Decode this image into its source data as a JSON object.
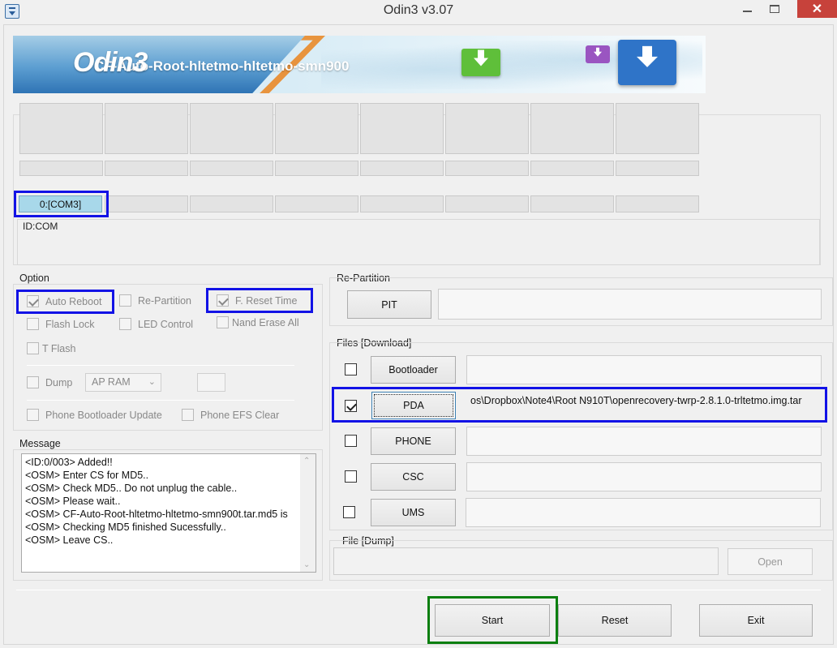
{
  "window": {
    "title": "Odin3 v3.07",
    "close_glyph": "✕"
  },
  "banner": {
    "logo": "Odin3",
    "filename": "CF-Auto-Root-hltetmo-hltetmo-smn900",
    "icons": [
      "download-green-icon",
      "download-purple-icon",
      "download-blue-icon"
    ]
  },
  "ports": {
    "com_active": "0:[COM3]",
    "id_com_label": "ID:COM"
  },
  "option": {
    "title": "Option",
    "auto_reboot": {
      "label": "Auto Reboot",
      "checked": true
    },
    "re_partition": {
      "label": "Re-Partition",
      "checked": false
    },
    "f_reset_time": {
      "label": "F. Reset Time",
      "checked": true
    },
    "flash_lock": {
      "label": "Flash Lock",
      "checked": false
    },
    "led_control": {
      "label": "LED Control",
      "checked": false
    },
    "nand_erase_all": {
      "label": "Nand Erase All",
      "checked": false
    },
    "t_flash": {
      "label": "T Flash",
      "checked": false
    },
    "dump": {
      "label": "Dump",
      "checked": false
    },
    "dump_select": "AP RAM",
    "phone_bootloader_update": {
      "label": "Phone Bootloader Update",
      "checked": false
    },
    "phone_efs_clear": {
      "label": "Phone EFS Clear",
      "checked": false
    }
  },
  "message": {
    "title": "Message",
    "lines": [
      "<ID:0/003> Added!!",
      "<OSM> Enter CS for MD5..",
      "<OSM> Check MD5.. Do not unplug the cable..",
      "<OSM> Please wait..",
      "<OSM> CF-Auto-Root-hltetmo-hltetmo-smn900t.tar.md5 is",
      "<OSM> Checking MD5 finished Sucessfully..",
      "<OSM> Leave CS.."
    ]
  },
  "repartition": {
    "title": "Re-Partition",
    "pit_label": "PIT",
    "pit_value": ""
  },
  "files": {
    "title": "Files [Download]",
    "bootloader": {
      "label": "Bootloader",
      "checked": false,
      "value": ""
    },
    "pda": {
      "label": "PDA",
      "checked": true,
      "value": "os\\Dropbox\\Note4\\Root N910T\\openrecovery-twrp-2.8.1.0-trltetmo.img.tar"
    },
    "phone": {
      "label": "PHONE",
      "checked": false,
      "value": ""
    },
    "csc": {
      "label": "CSC",
      "checked": false,
      "value": ""
    },
    "ums": {
      "label": "UMS",
      "checked": false,
      "value": ""
    }
  },
  "dump_file": {
    "title": "File [Dump]",
    "value": "",
    "open_label": "Open"
  },
  "actions": {
    "start": "Start",
    "reset": "Reset",
    "exit": "Exit"
  },
  "colors": {
    "highlight_blue": "#1212e6",
    "highlight_green": "#0a7f10",
    "com_active_bg": "#a8d8ea",
    "close_red": "#c7423b"
  }
}
